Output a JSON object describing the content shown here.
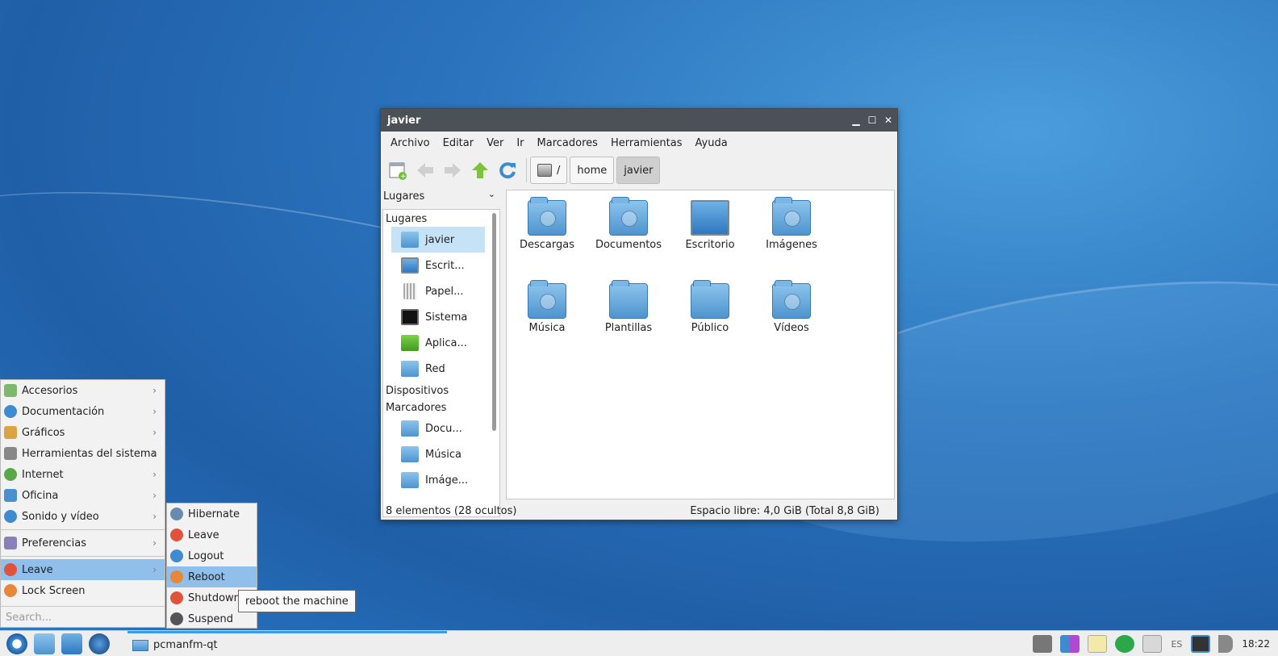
{
  "window": {
    "title": "javier",
    "controls": [
      "minimize-icon",
      "maximize-icon",
      "close-icon"
    ]
  },
  "menubar": [
    "Archivo",
    "Editar",
    "Ver",
    "Ir",
    "Marcadores",
    "Herramientas",
    "Ayuda"
  ],
  "breadcrumbs": [
    "/",
    "home",
    "javier"
  ],
  "sidebar": {
    "header": "Lugares",
    "groups": {
      "places": "Lugares",
      "devices": "Dispositivos",
      "bookmarks": "Marcadores"
    },
    "places": [
      "javier",
      "Escrit...",
      "Papel...",
      "Sistema",
      "Aplica...",
      "Red"
    ],
    "bookmarks": [
      "Docu...",
      "Música",
      "Imáge..."
    ]
  },
  "files": [
    "Descargas",
    "Documentos",
    "Escritorio",
    "Imágenes",
    "Música",
    "Plantillas",
    "Público",
    "Vídeos"
  ],
  "status": {
    "left": "8 elementos (28 ocultos)",
    "right": "Espacio libre: 4,0 GiB (Total 8,8 GiB)"
  },
  "start_menu": {
    "items": [
      "Accesorios",
      "Documentación",
      "Gráficos",
      "Herramientas del sistema",
      "Internet",
      "Oficina",
      "Sonido y vídeo"
    ],
    "preferences": "Preferencias",
    "leave": "Leave",
    "lock": "Lock Screen",
    "search_placeholder": "Search..."
  },
  "leave_submenu": [
    "Hibernate",
    "Leave",
    "Logout",
    "Reboot",
    "Shutdown",
    "Suspend"
  ],
  "tooltip": "reboot the machine",
  "taskbar": {
    "task": "pcmanfm-qt",
    "lang": "ES",
    "clock": "18:22"
  },
  "colors": {
    "titlebar": "#4b5156",
    "highlight": "#8fbfea",
    "selection": "#c6e2f7",
    "task_accent": "#3c9be8"
  }
}
